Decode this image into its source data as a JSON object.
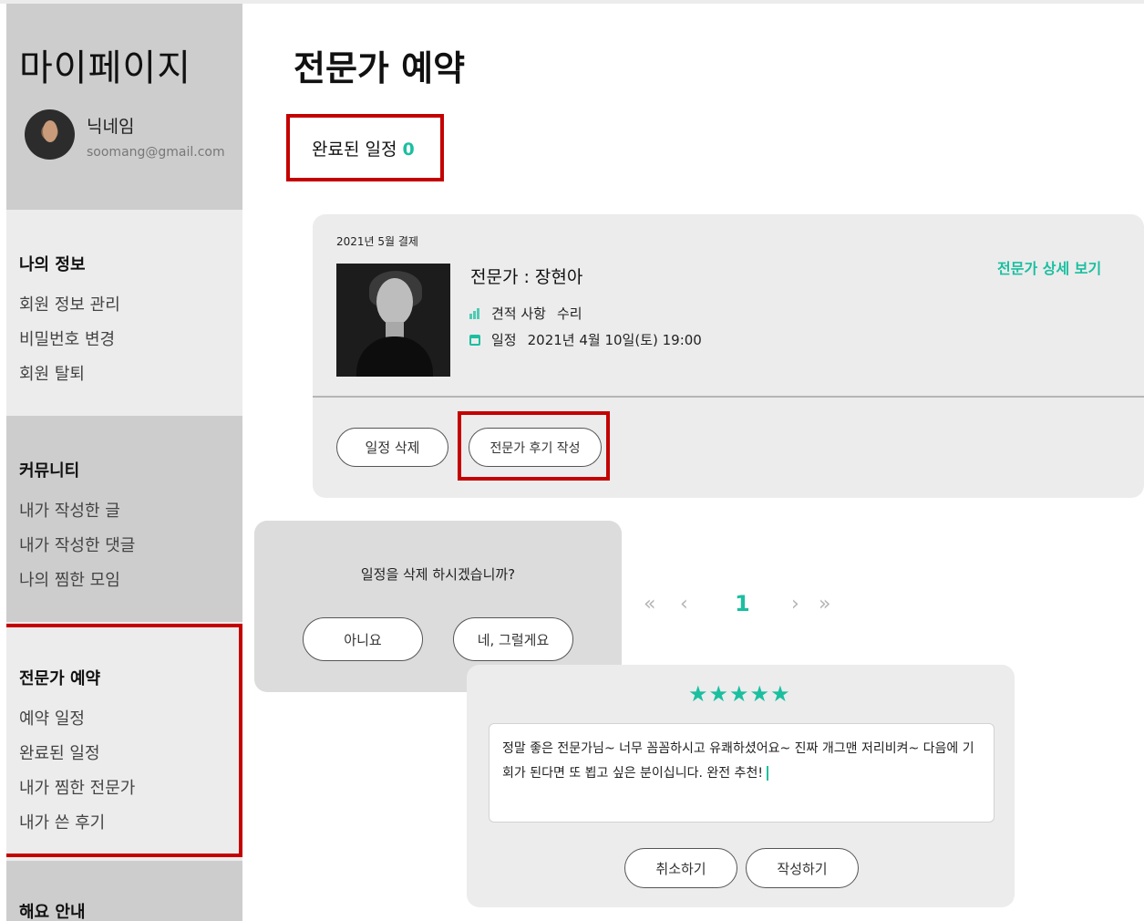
{
  "sidebar": {
    "title": "마이페이지",
    "profile": {
      "nickname": "닉네임",
      "email": "soomang@gmail.com"
    },
    "groups": [
      {
        "heading": "나의 정보",
        "items": [
          "회원 정보 관리",
          "비밀번호 변경",
          "회원 탈퇴"
        ]
      },
      {
        "heading": "커뮤니티",
        "items": [
          "내가 작성한 글",
          "내가 작성한 댓글",
          "나의 찜한 모임"
        ]
      },
      {
        "heading": "전문가 예약",
        "items": [
          "예약 일정",
          "완료된 일정",
          "내가 찜한 전문가",
          "내가 쓴 후기"
        ]
      },
      {
        "heading": "해요 안내",
        "items": []
      }
    ]
  },
  "main": {
    "title": "전문가 예약",
    "completed_label": "완료된 일정",
    "completed_count": "0"
  },
  "card": {
    "date": "2021년 5월 결제",
    "expert_name": "전문가 : 장현아",
    "detail_link": "전문가 상세 보기",
    "estimate_label": "견적 사항",
    "estimate_value": "수리",
    "schedule_label": "일정",
    "schedule_value": "2021년 4월 10일(토) 19:00",
    "delete_button": "일정 삭제",
    "review_button": "전문가 후기 작성"
  },
  "dialog": {
    "message": "일정을 삭제 하시겠습니까?",
    "no_button": "아니요",
    "yes_button": "네, 그럴게요"
  },
  "pagination": {
    "first": "«",
    "prev": "‹",
    "current": "1",
    "next": "›",
    "last": "»"
  },
  "review": {
    "stars": "★★★★★",
    "rating": 5,
    "text": "정말 좋은 전문가님~ 너무 꼼꼼하시고 유쾌하셨어요~ 진짜 개그맨 저리비켜~ 다음에 기회가 된다면 또 뵙고 싶은 분이십니다. 완전 추천!",
    "cancel_button": "취소하기",
    "submit_button": "작성하기"
  },
  "colors": {
    "accent": "#1bbfa0",
    "highlight_border": "#c40000",
    "sidebar_dark": "#cdcdcd",
    "sidebar_light": "#ececec"
  },
  "icons": [
    "estimate-icon",
    "calendar-icon"
  ]
}
